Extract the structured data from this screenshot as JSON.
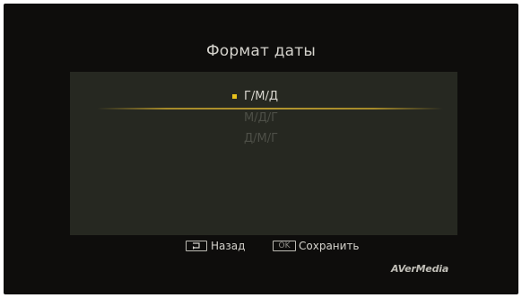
{
  "dialog": {
    "title": "Формат даты"
  },
  "options": [
    {
      "label": "Г/М/Д",
      "selected": true
    },
    {
      "label": "М/Д/Г",
      "selected": false
    },
    {
      "label": "Д/М/Г",
      "selected": false
    }
  ],
  "footer": {
    "back_key_icon": "return-arrow-icon",
    "back_label": "Назад",
    "ok_key_label": "OK",
    "save_label": "Сохранить"
  },
  "brand": {
    "logo_text": "AVerMedia"
  },
  "colors": {
    "background": "#0e0d0c",
    "panel": "#262821",
    "accent": "#e8c21c",
    "text": "#d4d2cc",
    "disabled_text": "#4d4f47"
  }
}
